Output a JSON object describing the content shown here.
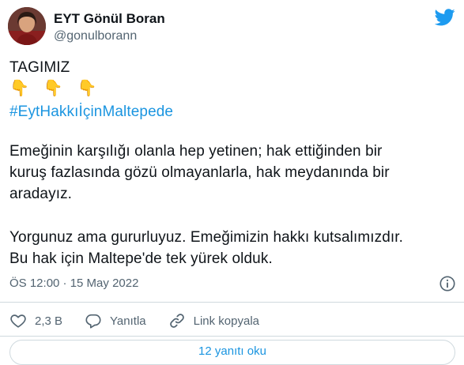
{
  "author": {
    "name": "EYT Gönül Boran",
    "handle": "@gonulborann"
  },
  "tweet": {
    "line1": "TAGIMIZ",
    "emojis": [
      "👇",
      "👇",
      "👇"
    ],
    "hashtag": "#EytHakkıİçinMaltepede",
    "para1": [
      "Emeğinin karşılığı olanla hep yetinen; hak ettiğinden bir",
      "kuruş fazlasında gözü olmayanlarla, hak meydanında bir",
      "aradayız."
    ],
    "para2": [
      "Yorgunuz ama gururluyuz. Emeğimizin hakkı kutsalımızdır.",
      "Bu hak için Maltepe'de tek yürek olduk."
    ]
  },
  "meta": {
    "timestamp": "ÖS 12:00 · 15 May 2022"
  },
  "actions": {
    "like_count": "2,3 B",
    "reply_label": "Yanıtla",
    "copy_link_label": "Link kopyala"
  },
  "more_bar_label": "12 yanıtı oku",
  "colors": {
    "link": "#1b95e0",
    "muted": "#536471",
    "like": "#f91880"
  },
  "icons": [
    "twitter-bird-icon",
    "info-icon",
    "heart-icon",
    "reply-icon",
    "link-icon"
  ]
}
